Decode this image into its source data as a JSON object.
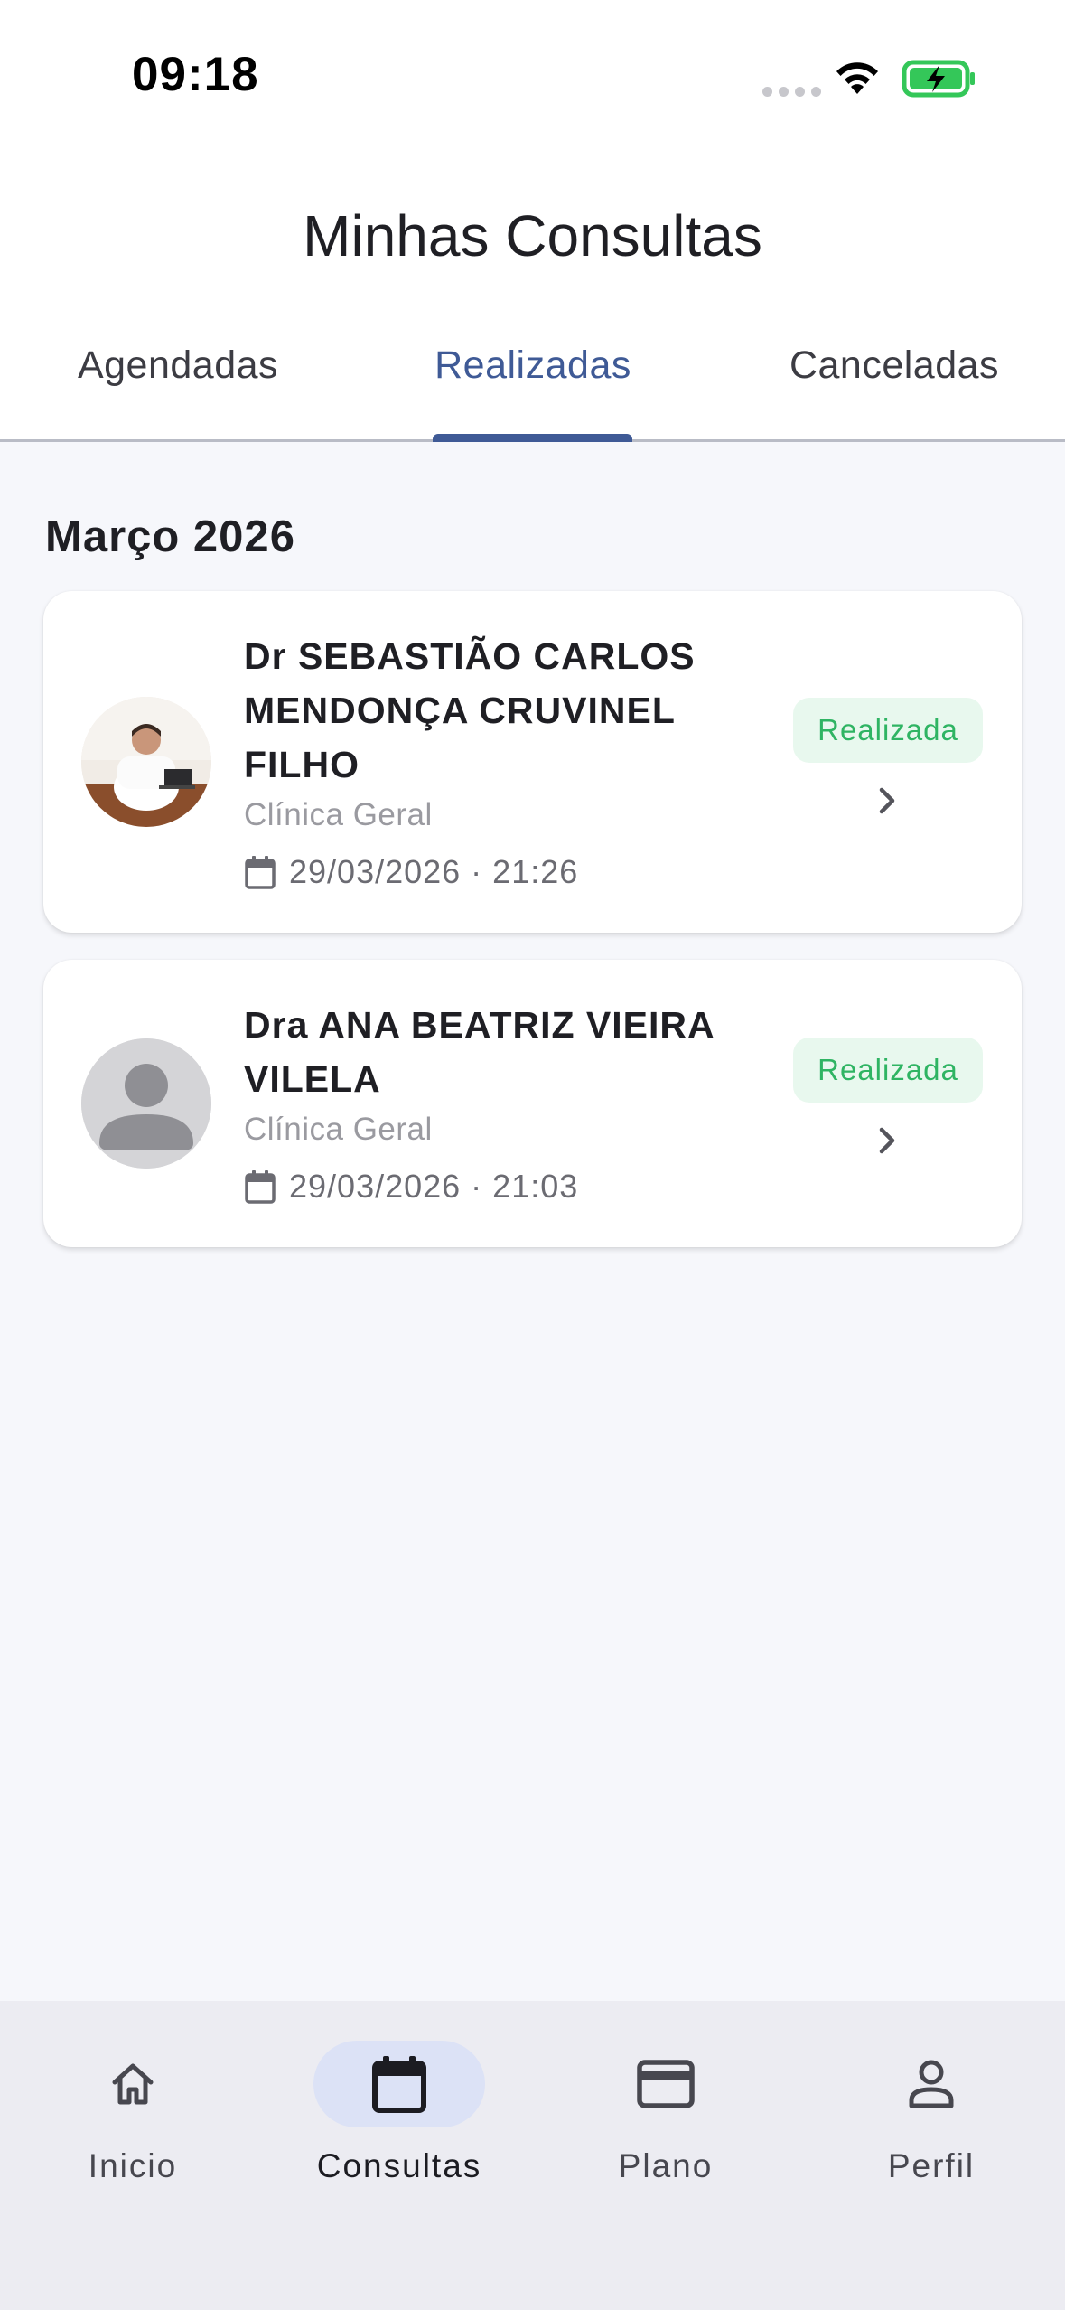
{
  "status_bar": {
    "time": "09:18"
  },
  "header": {
    "title": "Minhas Consultas"
  },
  "tabs": [
    {
      "label": "Agendadas",
      "active": false
    },
    {
      "label": "Realizadas",
      "active": true
    },
    {
      "label": "Canceladas",
      "active": false
    }
  ],
  "section": {
    "title": "Março 2026"
  },
  "appointments": [
    {
      "doctor": "Dr SEBASTIÃO CARLOS MENDONÇA CRUVINEL FILHO",
      "specialty": "Clínica Geral",
      "datetime": "29/03/2026 · 21:26",
      "status": "Realizada",
      "avatar": "doctor-photo"
    },
    {
      "doctor": "Dra ANA BEATRIZ VIEIRA VILELA",
      "specialty": "Clínica Geral",
      "datetime": "29/03/2026 · 21:03",
      "status": "Realizada",
      "avatar": "default-person-icon"
    }
  ],
  "bottom_nav": [
    {
      "label": "Inicio",
      "icon": "home-icon",
      "active": false
    },
    {
      "label": "Consultas",
      "icon": "calendar-icon",
      "active": true
    },
    {
      "label": "Plano",
      "icon": "card-icon",
      "active": false
    },
    {
      "label": "Perfil",
      "icon": "person-icon",
      "active": false
    }
  ],
  "colors": {
    "accent": "#3f5a96",
    "status_green": "#2fb463",
    "status_bg": "#e8f8ee",
    "nav_active_bg": "#dce2f6"
  }
}
